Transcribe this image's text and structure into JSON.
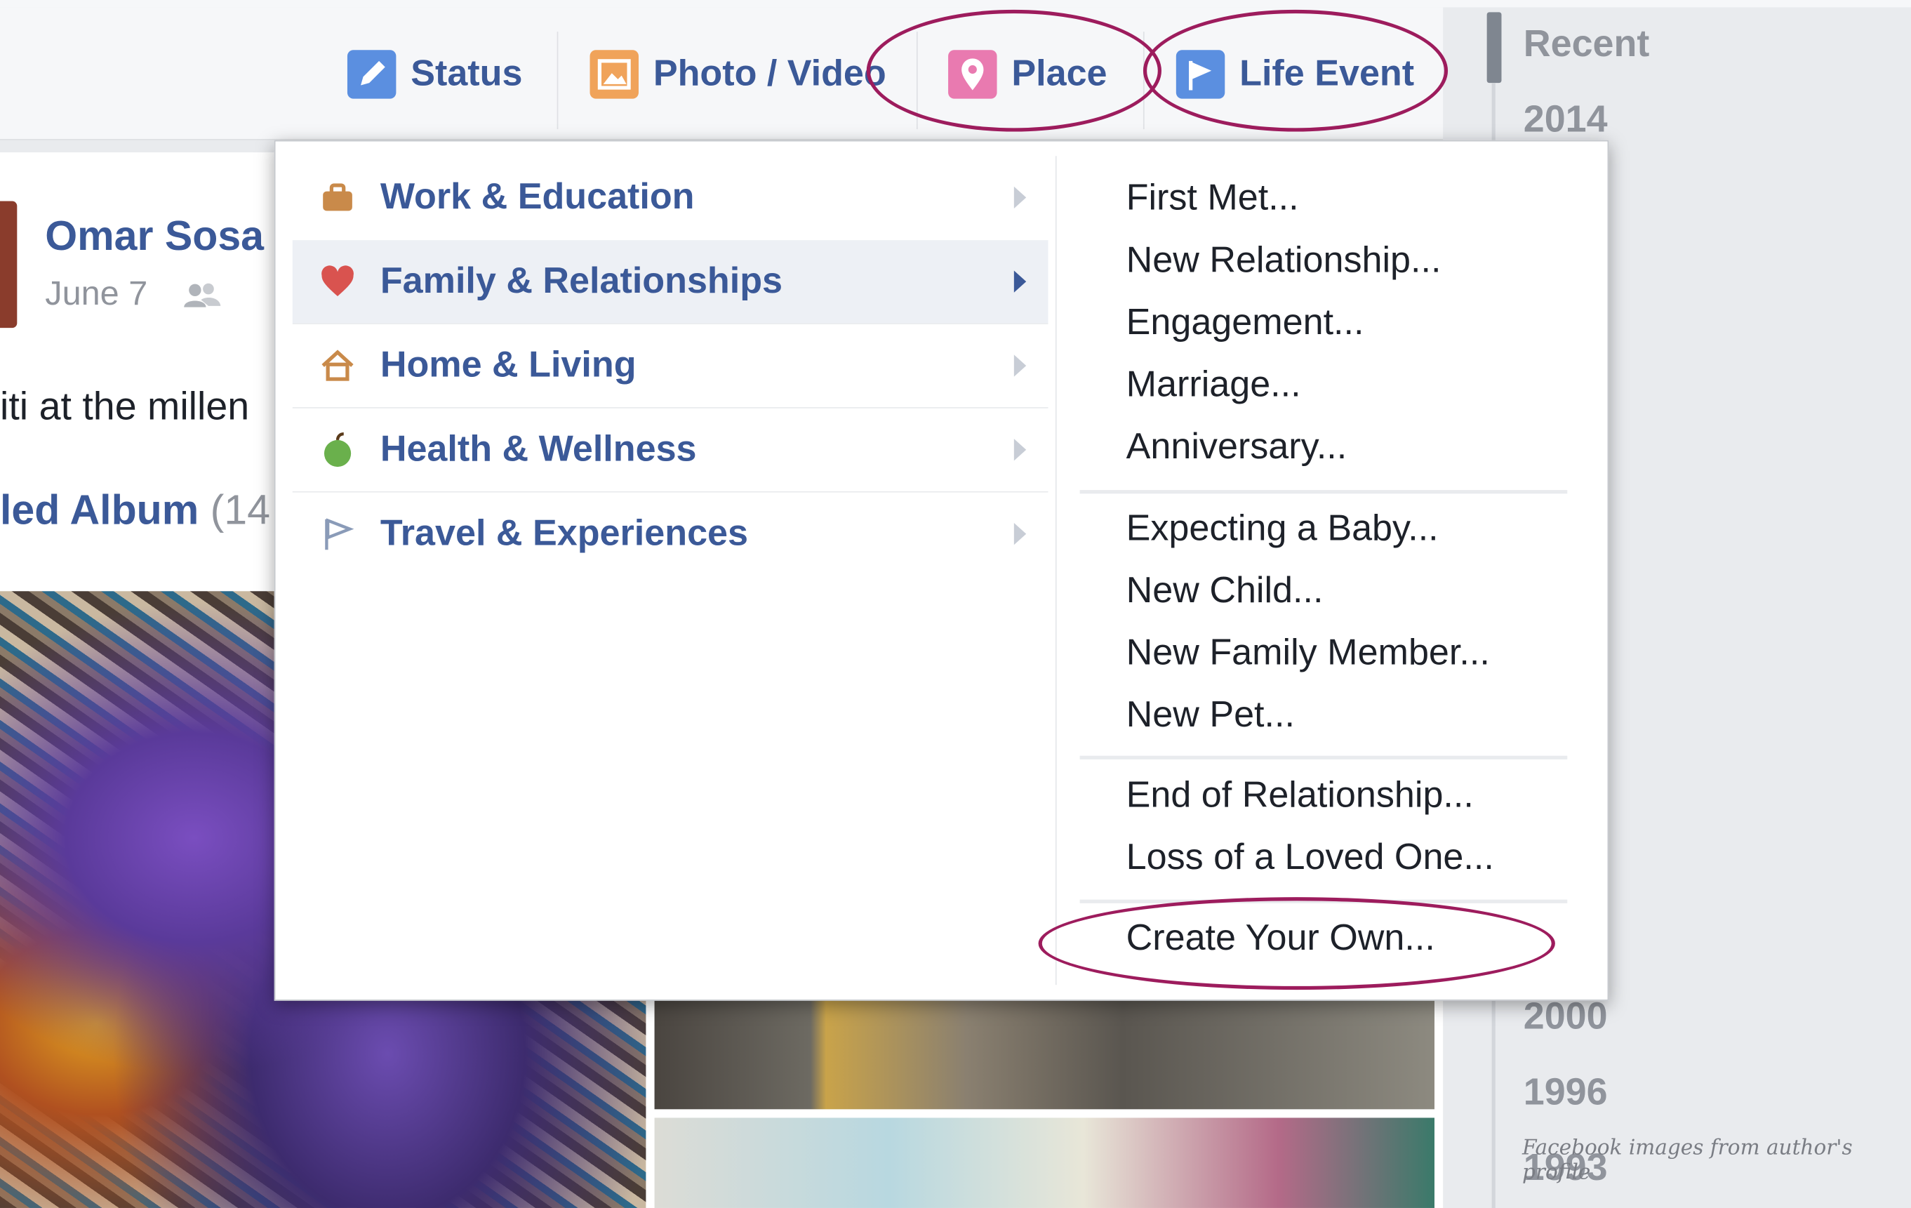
{
  "composer": {
    "status_label": "Status",
    "photo_label": "Photo / Video",
    "place_label": "Place",
    "life_event_label": "Life Event"
  },
  "post": {
    "author": "Omar Sosa",
    "date": "June 7",
    "text": "iti at the millen",
    "album_title": "led Album",
    "album_count": "(14"
  },
  "timeline": {
    "items": [
      "Recent",
      "2014",
      "2000",
      "1996",
      "1993"
    ]
  },
  "dropdown": {
    "categories": [
      {
        "label": "Work & Education",
        "icon": "briefcase-icon"
      },
      {
        "label": "Family & Relationships",
        "icon": "heart-icon"
      },
      {
        "label": "Home & Living",
        "icon": "house-icon"
      },
      {
        "label": "Health & Wellness",
        "icon": "apple-icon"
      },
      {
        "label": "Travel & Experiences",
        "icon": "flag-icon"
      }
    ],
    "selected_category": "Family & Relationships",
    "subitems": [
      "First Met...",
      "New Relationship...",
      "Engagement...",
      "Marriage...",
      "Anniversary...",
      "Expecting a Baby...",
      "New Child...",
      "New Family Member...",
      "New Pet...",
      "End of Relationship...",
      "Loss of a Loved One...",
      "Create Your Own..."
    ]
  },
  "caption": "Facebook images from author's profile",
  "colors": {
    "link_blue": "#3b5998",
    "highlight_ring": "#9d1c5d",
    "status_icon": "#5b8fe0",
    "photo_icon": "#f0a35a",
    "place_icon": "#e97ab0",
    "life_event_icon": "#5b8fe0"
  }
}
